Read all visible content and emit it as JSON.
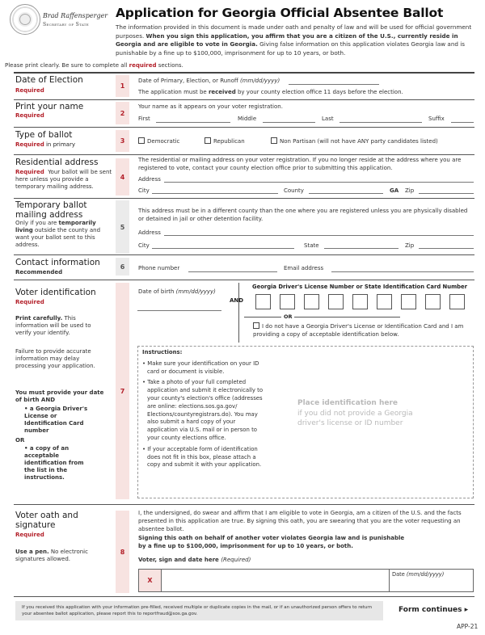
{
  "header": {
    "official_name": "Brad Raffensperger",
    "official_title": "Secretary of State",
    "title": "Application for Georgia Official Absentee Ballot",
    "intro_part1": "The information provided in this document is made under oath and penalty of law and will be used for official government purposes. ",
    "intro_bold": "When you sign this application, you affirm that you are a citizen of the U.S., currently reside in Georgia and are eligible to vote in Georgia.",
    "intro_part2": " Giving false information on this application violates Georgia law and is punishable by a fine up to $100,000, imprisonment for up to 10 years, or both.",
    "print_note_pre": "Please print clearly. Be sure to complete all ",
    "print_note_required": "required",
    "print_note_post": " sections."
  },
  "colors": {
    "accent_red": "#b3202a",
    "number_bg_pink": "#f7e3e1",
    "number_bg_gray": "#ebebeb",
    "footer_bg": "#e7e7e7",
    "placeholder_gray": "#b9b9b9"
  },
  "sections": {
    "s1": {
      "number": "1",
      "label": "Date of Election",
      "status": "Required",
      "field_label": "Date of Primary, Election, or Runoff ",
      "field_format": "(mm/dd/yyyy)",
      "note_pre": "The application must be ",
      "note_bold": "received",
      "note_post": " by your county election office 11 days before the election."
    },
    "s2": {
      "number": "2",
      "label": "Print your name",
      "status": "Required",
      "instruction": "Your name as it appears on your voter registration.",
      "fields": {
        "first": "First",
        "middle": "Middle",
        "last": "Last",
        "suffix": "Suffix"
      }
    },
    "s3": {
      "number": "3",
      "label": "Type of ballot",
      "status": "Required",
      "status_suffix": " in primary",
      "options": [
        "Democratic",
        "Republican",
        "Non Partisan (will not have ANY party candidates listed)"
      ]
    },
    "s4": {
      "number": "4",
      "label": "Residential address",
      "status": "Required",
      "sub_text": "Your ballot will be sent here unless you provide a temporary mailing address.",
      "instruction": "The residential or mailing address on your voter registration. If you no longer reside at the address where you are registered to vote, contact your county election office prior to submitting this application.",
      "fields": {
        "address": "Address",
        "city": "City",
        "county": "County",
        "state_fixed": "GA",
        "zip": "Zip"
      }
    },
    "s5": {
      "number": "5",
      "label": "Temporary ballot mailing address",
      "sub_pre": "Only if you are ",
      "sub_bold": "temporarily living",
      "sub_post": " outside the county and want your ballot sent to this address.",
      "instruction": "This address must be in a different county than the one where you are registered unless you are physically disabled or detained in jail or other detention facility.",
      "fields": {
        "address": "Address",
        "city": "City",
        "state": "State",
        "zip": "Zip"
      }
    },
    "s6": {
      "number": "6",
      "label": "Contact information",
      "status": "Recommended",
      "fields": {
        "phone": "Phone number",
        "email": "Email address"
      }
    },
    "s7": {
      "number": "7",
      "label": "Voter identification",
      "status": "Required",
      "print_carefully_bold": "Print carefully.",
      "print_carefully_rest": " This information will be used to verify your identify.",
      "failure_note": "Failure to provide accurate information may delay processing your application.",
      "must_provide": "You must provide your date of birth AND",
      "option_a": "a Georgia Driver's License or Identification Card number",
      "or_label": "OR",
      "option_b": "a copy of an acceptable identification from the list in the instructions.",
      "dob_label": "Date of birth ",
      "dob_format": "(mm/dd/yyyy)",
      "and_label": "AND",
      "dl_label": "Georgia Driver's License Number or State Identification Card Number",
      "dl_box_count": 9,
      "or_divider": "OR",
      "no_id_checkbox": "I do not have a Georgia Driver's License or Identification Card and I am providing a copy of acceptable identification below.",
      "instructions_title": "Instructions:",
      "instructions": [
        "Make sure your identification on your ID card or document is visible.",
        "Take a photo of your full completed application and submit it electronically to your county's election's office (addresses are online: elections.sos.ga.gov/ Elections/countyregistrars.do). You may also submit a hard copy of your application via U.S. mail or in person to your county elections office.",
        "If your acceptable form of identification does not fit in this box, please attach a copy and submit it with your application."
      ],
      "placeholder_title": "Place identification here",
      "placeholder_sub": "if you did not provide a Georgia driver's license or ID number"
    },
    "s8": {
      "number": "8",
      "label": "Voter oath and signature",
      "status": "Required",
      "pen_bold": "Use a pen.",
      "pen_rest": " No electronic signatures allowed.",
      "oath": "I, the undersigned, do swear and affirm that I am eligible to vote in Georgia, am a citizen of the U.S. and the facts presented in this application are true. By signing this oath, you are swearing that you are the voter requesting an absentee ballot.",
      "warning": "Signing this oath on behalf of another voter violates Georgia law and is punishable by a fine up to $100,000, imprisonment for up to 10 years, or both.",
      "sign_label": "Voter, sign and date here ",
      "sign_required": "(Required)",
      "sign_marker": "X",
      "date_label": "Date ",
      "date_format": "(mm/dd/yyyy)"
    }
  },
  "footer": {
    "fraud_note": "If you received this application with your information pre-filled, received multiple or duplicate copies in the mail, or if an unauthorized person offers to return your absentee ballot application, please report this to reportfraud@sos.ga.gov.",
    "form_continues": "Form continues ▸",
    "form_code": "APP-21"
  }
}
